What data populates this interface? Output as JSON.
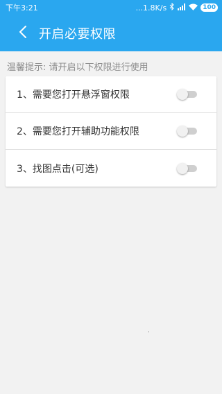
{
  "status_bar": {
    "time": "下午3:21",
    "network_speed": "...1.8K/s",
    "icons": [
      "bluetooth-icon",
      "signal-icon",
      "wifi-icon"
    ],
    "battery": "100"
  },
  "app_bar": {
    "back_icon": "chevron-left-icon",
    "title": "开启必要权限"
  },
  "hint": "温馨提示: 请开启以下权限进行使用",
  "permissions": [
    {
      "label": "1、需要您打开悬浮窗权限",
      "enabled": false
    },
    {
      "label": "2、需要您打开辅助功能权限",
      "enabled": false
    },
    {
      "label": "3、找图点击(可选)",
      "enabled": false
    }
  ],
  "colors": {
    "primary": "#2aa7ef",
    "background": "#f2f2f2",
    "hint_text": "#8c8c8c",
    "switch_track_off": "#cfcfcf"
  }
}
